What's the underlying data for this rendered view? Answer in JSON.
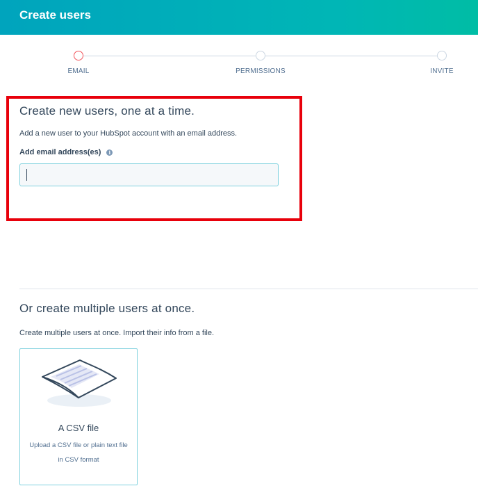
{
  "header": {
    "title": "Create users"
  },
  "stepper": {
    "steps": [
      {
        "label": "EMAIL",
        "active": true
      },
      {
        "label": "PERMISSIONS",
        "active": false
      },
      {
        "label": "INVITE",
        "active": false
      }
    ]
  },
  "single": {
    "title": "Create new users, one at a time.",
    "description": "Add a new user to your HubSpot account with an email address.",
    "field_label": "Add email address(es)",
    "info_icon": "info-icon",
    "input_value": ""
  },
  "multiple": {
    "title": "Or create multiple users at once.",
    "description": "Create multiple users at once. Import their info from a file.",
    "csv_card": {
      "title": "A CSV file",
      "description": "Upload a CSV file or plain text file in CSV format",
      "icon": "csv-file-icon"
    }
  },
  "colors": {
    "header_gradient_start": "#00a4bd",
    "header_gradient_end": "#00bda5",
    "highlight": "#e8000b",
    "active_step": "#f2545b",
    "text": "#33475b"
  }
}
